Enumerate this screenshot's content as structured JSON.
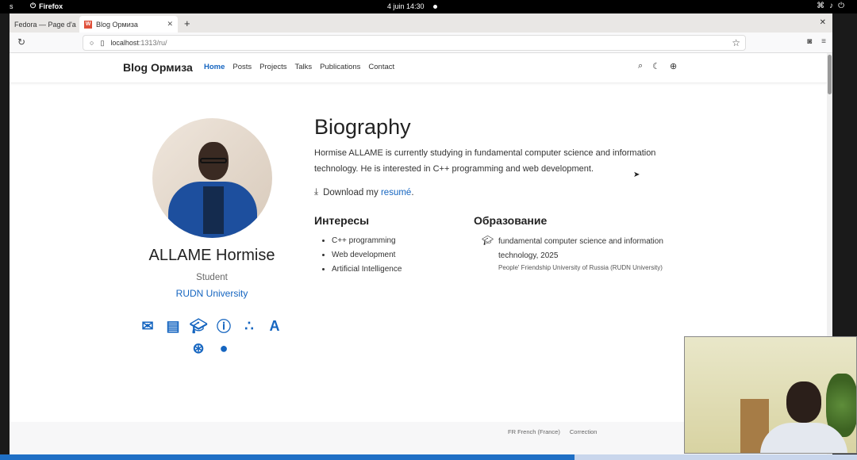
{
  "system": {
    "activities": "s",
    "app_name": "Firefox",
    "clock": "4 juin  14:30"
  },
  "browser": {
    "tabs": [
      {
        "label": "Fedora — Page d'a"
      },
      {
        "label": "Blog Ормиза",
        "favicon": "W"
      }
    ],
    "url_host": "localhost",
    "url_path": ":1313/ru/"
  },
  "site": {
    "brand": "Blog Ормиза",
    "menu": [
      "Home",
      "Posts",
      "Projects",
      "Talks",
      "Publications",
      "Contact"
    ],
    "active_menu": "Home"
  },
  "profile": {
    "name": "ALLAME Hormise",
    "role": "Student",
    "organization": "RUDN University",
    "icons": [
      "envelope-icon",
      "book-icon",
      "graduation-cap-icon",
      "orcid-icon",
      "mendeley-icon",
      "academia-icon",
      "researchgate-icon",
      "github-icon"
    ]
  },
  "biography": {
    "title": "Biography",
    "text": "Hormise ALLAME is currently studying in fundamental computer science and information technology. He is interested in C++ programming and web development.",
    "download_prefix": "Download my ",
    "download_link": "resumé",
    "download_suffix": "."
  },
  "interests": {
    "title": "Интересы",
    "items": [
      "C++ programming",
      "Web development",
      "Artificial Intelligence"
    ]
  },
  "education": {
    "title": "Образование",
    "course": "fundamental computer science and information technology, 2025",
    "institution": "People' Friendship University of Russia (RUDN University)"
  },
  "statusbar": {
    "language": "FR French (France)",
    "correction": "Correction"
  },
  "progress": 0.67
}
